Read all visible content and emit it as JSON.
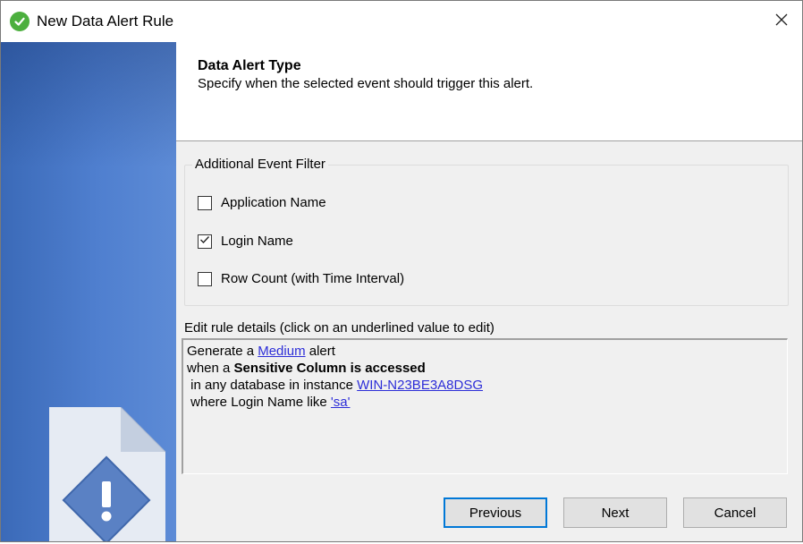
{
  "window": {
    "title": "New Data Alert Rule",
    "title_icon": "check-circle-icon",
    "close_icon": "close-icon"
  },
  "header": {
    "title": "Data Alert Type",
    "subtitle": "Specify when the selected event should trigger this alert."
  },
  "filter_group": {
    "legend": "Additional Event Filter",
    "options": [
      {
        "label": "Application Name",
        "checked": false
      },
      {
        "label": "Login Name",
        "checked": true
      },
      {
        "label": "Row Count (with Time Interval)",
        "checked": false
      }
    ]
  },
  "details": {
    "label": "Edit rule details (click on an underlined value to edit)",
    "line1_prefix": "Generate a ",
    "severity": "Medium",
    "line1_suffix": " alert",
    "line2_prefix": "when a ",
    "line2_bold": "Sensitive Column is accessed",
    "line3_prefix": " in any database in instance ",
    "instance": "WIN-N23BE3A8DSG",
    "line4_prefix": " where Login Name like ",
    "login_value": "'sa'"
  },
  "buttons": {
    "previous": "Previous",
    "next": "Next",
    "cancel": "Cancel"
  },
  "colors": {
    "accent": "#0078d7",
    "link": "#2d2ed8",
    "sidebar": "#4f7fcf",
    "title_icon": "#4caf3e"
  }
}
